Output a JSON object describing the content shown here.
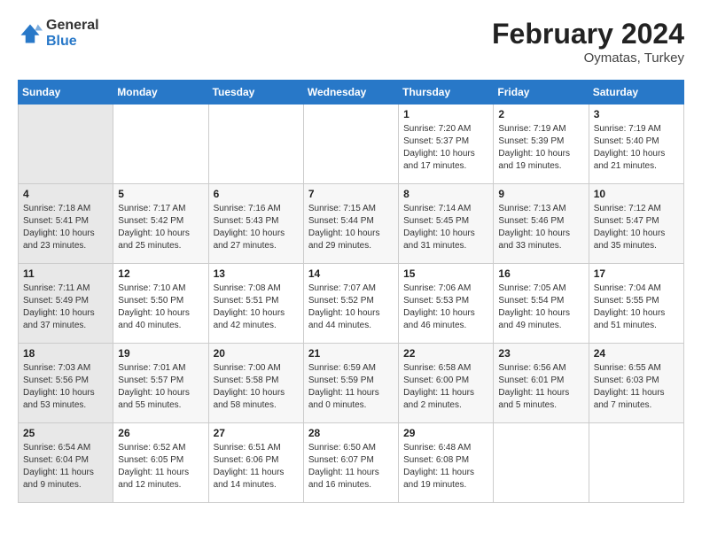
{
  "header": {
    "logo_general": "General",
    "logo_blue": "Blue",
    "month_year": "February 2024",
    "location": "Oymatas, Turkey"
  },
  "days_of_week": [
    "Sunday",
    "Monday",
    "Tuesday",
    "Wednesday",
    "Thursday",
    "Friday",
    "Saturday"
  ],
  "weeks": [
    [
      {
        "day": "",
        "info": ""
      },
      {
        "day": "",
        "info": ""
      },
      {
        "day": "",
        "info": ""
      },
      {
        "day": "",
        "info": ""
      },
      {
        "day": "1",
        "info": "Sunrise: 7:20 AM\nSunset: 5:37 PM\nDaylight: 10 hours\nand 17 minutes."
      },
      {
        "day": "2",
        "info": "Sunrise: 7:19 AM\nSunset: 5:39 PM\nDaylight: 10 hours\nand 19 minutes."
      },
      {
        "day": "3",
        "info": "Sunrise: 7:19 AM\nSunset: 5:40 PM\nDaylight: 10 hours\nand 21 minutes."
      }
    ],
    [
      {
        "day": "4",
        "info": "Sunrise: 7:18 AM\nSunset: 5:41 PM\nDaylight: 10 hours\nand 23 minutes."
      },
      {
        "day": "5",
        "info": "Sunrise: 7:17 AM\nSunset: 5:42 PM\nDaylight: 10 hours\nand 25 minutes."
      },
      {
        "day": "6",
        "info": "Sunrise: 7:16 AM\nSunset: 5:43 PM\nDaylight: 10 hours\nand 27 minutes."
      },
      {
        "day": "7",
        "info": "Sunrise: 7:15 AM\nSunset: 5:44 PM\nDaylight: 10 hours\nand 29 minutes."
      },
      {
        "day": "8",
        "info": "Sunrise: 7:14 AM\nSunset: 5:45 PM\nDaylight: 10 hours\nand 31 minutes."
      },
      {
        "day": "9",
        "info": "Sunrise: 7:13 AM\nSunset: 5:46 PM\nDaylight: 10 hours\nand 33 minutes."
      },
      {
        "day": "10",
        "info": "Sunrise: 7:12 AM\nSunset: 5:47 PM\nDaylight: 10 hours\nand 35 minutes."
      }
    ],
    [
      {
        "day": "11",
        "info": "Sunrise: 7:11 AM\nSunset: 5:49 PM\nDaylight: 10 hours\nand 37 minutes."
      },
      {
        "day": "12",
        "info": "Sunrise: 7:10 AM\nSunset: 5:50 PM\nDaylight: 10 hours\nand 40 minutes."
      },
      {
        "day": "13",
        "info": "Sunrise: 7:08 AM\nSunset: 5:51 PM\nDaylight: 10 hours\nand 42 minutes."
      },
      {
        "day": "14",
        "info": "Sunrise: 7:07 AM\nSunset: 5:52 PM\nDaylight: 10 hours\nand 44 minutes."
      },
      {
        "day": "15",
        "info": "Sunrise: 7:06 AM\nSunset: 5:53 PM\nDaylight: 10 hours\nand 46 minutes."
      },
      {
        "day": "16",
        "info": "Sunrise: 7:05 AM\nSunset: 5:54 PM\nDaylight: 10 hours\nand 49 minutes."
      },
      {
        "day": "17",
        "info": "Sunrise: 7:04 AM\nSunset: 5:55 PM\nDaylight: 10 hours\nand 51 minutes."
      }
    ],
    [
      {
        "day": "18",
        "info": "Sunrise: 7:03 AM\nSunset: 5:56 PM\nDaylight: 10 hours\nand 53 minutes."
      },
      {
        "day": "19",
        "info": "Sunrise: 7:01 AM\nSunset: 5:57 PM\nDaylight: 10 hours\nand 55 minutes."
      },
      {
        "day": "20",
        "info": "Sunrise: 7:00 AM\nSunset: 5:58 PM\nDaylight: 10 hours\nand 58 minutes."
      },
      {
        "day": "21",
        "info": "Sunrise: 6:59 AM\nSunset: 5:59 PM\nDaylight: 11 hours\nand 0 minutes."
      },
      {
        "day": "22",
        "info": "Sunrise: 6:58 AM\nSunset: 6:00 PM\nDaylight: 11 hours\nand 2 minutes."
      },
      {
        "day": "23",
        "info": "Sunrise: 6:56 AM\nSunset: 6:01 PM\nDaylight: 11 hours\nand 5 minutes."
      },
      {
        "day": "24",
        "info": "Sunrise: 6:55 AM\nSunset: 6:03 PM\nDaylight: 11 hours\nand 7 minutes."
      }
    ],
    [
      {
        "day": "25",
        "info": "Sunrise: 6:54 AM\nSunset: 6:04 PM\nDaylight: 11 hours\nand 9 minutes."
      },
      {
        "day": "26",
        "info": "Sunrise: 6:52 AM\nSunset: 6:05 PM\nDaylight: 11 hours\nand 12 minutes."
      },
      {
        "day": "27",
        "info": "Sunrise: 6:51 AM\nSunset: 6:06 PM\nDaylight: 11 hours\nand 14 minutes."
      },
      {
        "day": "28",
        "info": "Sunrise: 6:50 AM\nSunset: 6:07 PM\nDaylight: 11 hours\nand 16 minutes."
      },
      {
        "day": "29",
        "info": "Sunrise: 6:48 AM\nSunset: 6:08 PM\nDaylight: 11 hours\nand 19 minutes."
      },
      {
        "day": "",
        "info": ""
      },
      {
        "day": "",
        "info": ""
      }
    ]
  ]
}
